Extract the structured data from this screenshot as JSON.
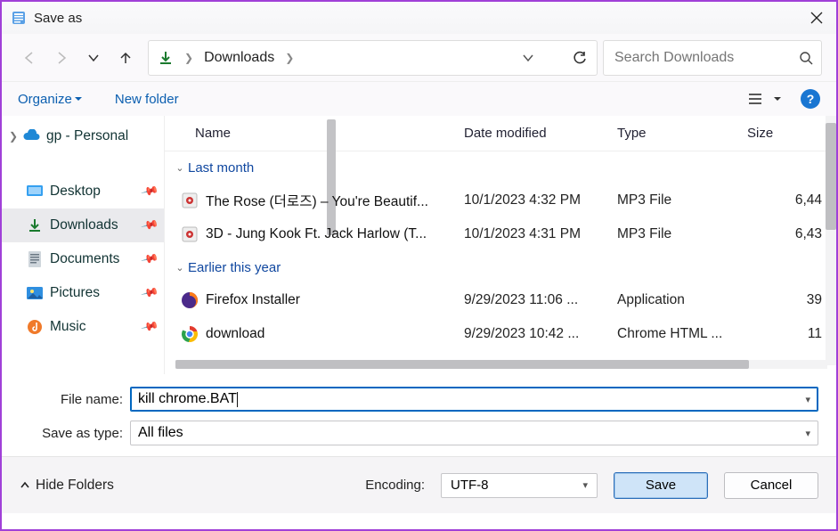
{
  "title": "Save as",
  "nav": {
    "location": "Downloads",
    "search_placeholder": "Search Downloads"
  },
  "toolbar": {
    "organize": "Organize",
    "new_folder": "New folder"
  },
  "sidebar": {
    "root": {
      "label": "gp - Personal"
    },
    "items": [
      {
        "id": "desktop",
        "label": "Desktop",
        "icon": "desktop",
        "pinned": true,
        "selected": false
      },
      {
        "id": "downloads",
        "label": "Downloads",
        "icon": "download",
        "pinned": true,
        "selected": true
      },
      {
        "id": "documents",
        "label": "Documents",
        "icon": "document",
        "pinned": true,
        "selected": false
      },
      {
        "id": "pictures",
        "label": "Pictures",
        "icon": "pictures",
        "pinned": true,
        "selected": false
      },
      {
        "id": "music",
        "label": "Music",
        "icon": "music",
        "pinned": true,
        "selected": false
      }
    ]
  },
  "columns": {
    "name": "Name",
    "date": "Date modified",
    "type": "Type",
    "size": "Size"
  },
  "groups": [
    {
      "label": "Last month",
      "files": [
        {
          "icon": "media",
          "name": "The Rose (더로즈) – You're Beautif...",
          "date": "10/1/2023 4:32 PM",
          "type": "MP3 File",
          "size": "6,44"
        },
        {
          "icon": "media",
          "name": "3D - Jung Kook Ft. Jack Harlow (T...",
          "date": "10/1/2023 4:31 PM",
          "type": "MP3 File",
          "size": "6,43"
        }
      ]
    },
    {
      "label": "Earlier this year",
      "files": [
        {
          "icon": "firefox",
          "name": "Firefox Installer",
          "date": "9/29/2023 11:06 ...",
          "type": "Application",
          "size": "39"
        },
        {
          "icon": "chrome",
          "name": "download",
          "date": "9/29/2023 10:42 ...",
          "type": "Chrome HTML ...",
          "size": "11"
        }
      ]
    }
  ],
  "fields": {
    "filename_label": "File name:",
    "filename_value": "kill chrome.BAT",
    "savetype_label": "Save as type:",
    "savetype_value": "All files"
  },
  "footer": {
    "hide_folders": "Hide Folders",
    "encoding_label": "Encoding:",
    "encoding_value": "UTF-8",
    "save": "Save",
    "cancel": "Cancel"
  }
}
